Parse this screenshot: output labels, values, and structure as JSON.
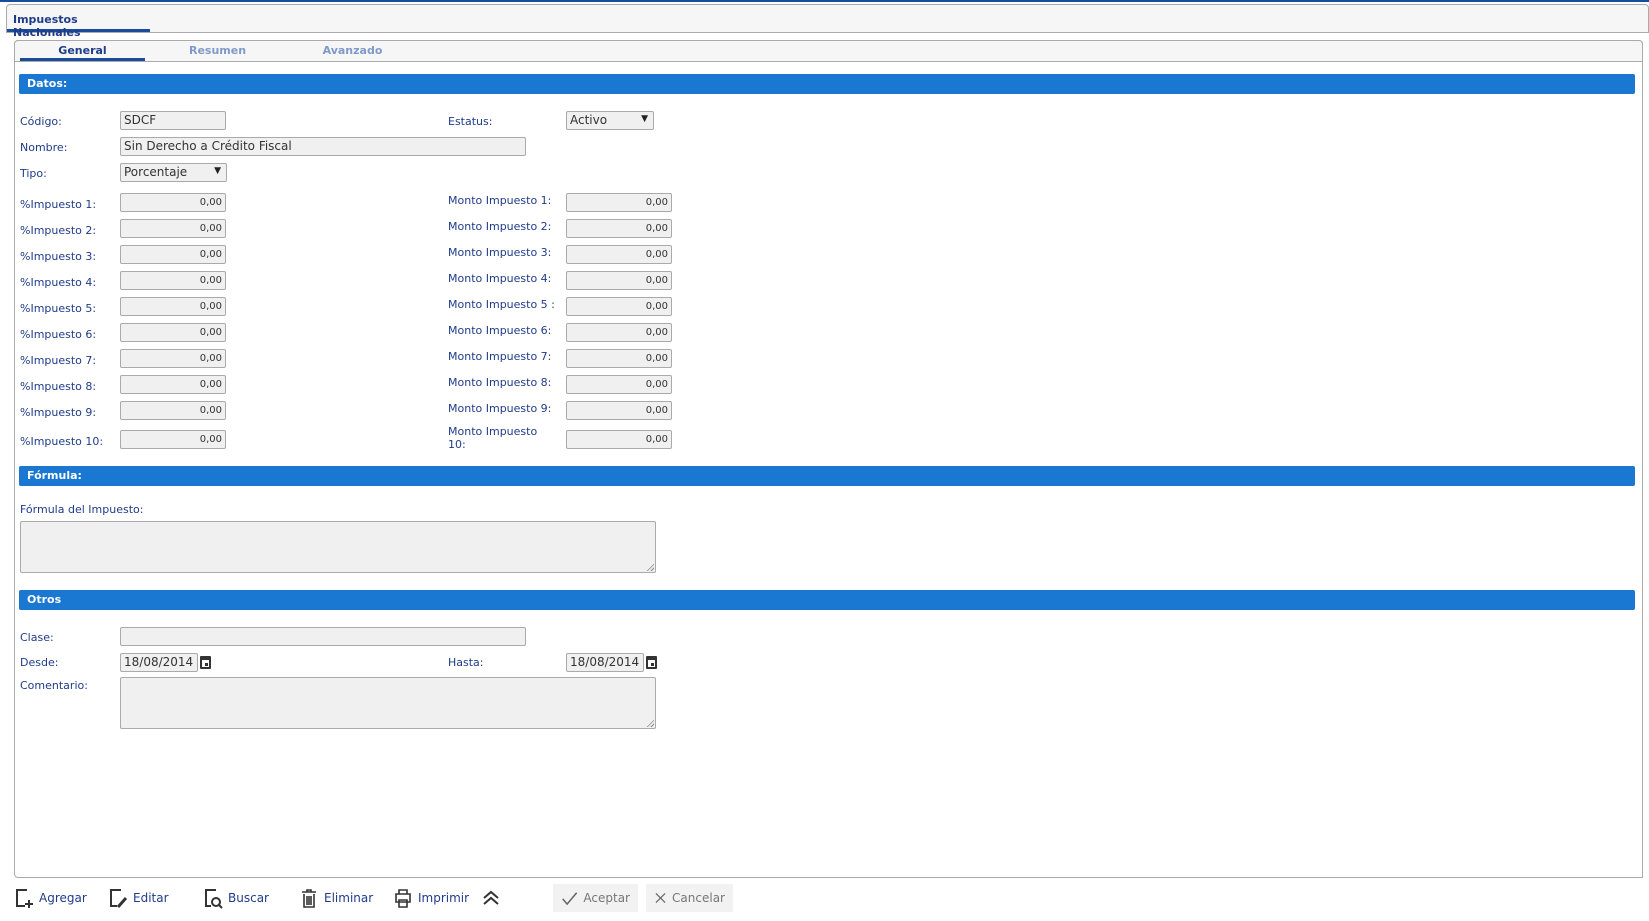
{
  "window": {
    "tab": "Impuestos Nacionales"
  },
  "subtabs": [
    "General",
    "Resumen",
    "Avanzado"
  ],
  "sections": {
    "datos": "Datos:",
    "formula": "Fórmula:",
    "otros": "Otros"
  },
  "datos": {
    "codigo_label": "Código:",
    "codigo": "SDCF",
    "estatus_label": "Estatus:",
    "estatus": "Activo",
    "nombre_label": "Nombre:",
    "nombre": "Sin Derecho a Crédito Fiscal",
    "tipo_label": "Tipo:",
    "tipo": "Porcentaje",
    "impuestos": [
      {
        "pct_label": "%Impuesto 1:",
        "pct": "0,00",
        "monto_label": "Monto Impuesto 1:",
        "monto": "0,00"
      },
      {
        "pct_label": "%Impuesto 2:",
        "pct": "0,00",
        "monto_label": "Monto Impuesto 2:",
        "monto": "0,00"
      },
      {
        "pct_label": "%Impuesto 3:",
        "pct": "0,00",
        "monto_label": "Monto Impuesto 3:",
        "monto": "0,00"
      },
      {
        "pct_label": "%Impuesto 4:",
        "pct": "0,00",
        "monto_label": "Monto Impuesto 4:",
        "monto": "0,00"
      },
      {
        "pct_label": "%Impuesto 5:",
        "pct": "0,00",
        "monto_label": "Monto Impuesto 5 :",
        "monto": "0,00"
      },
      {
        "pct_label": "%Impuesto 6:",
        "pct": "0,00",
        "monto_label": "Monto Impuesto 6:",
        "monto": "0,00"
      },
      {
        "pct_label": "%Impuesto 7:",
        "pct": "0,00",
        "monto_label": "Monto Impuesto 7:",
        "monto": "0,00"
      },
      {
        "pct_label": "%Impuesto 8:",
        "pct": "0,00",
        "monto_label": "Monto Impuesto 8:",
        "monto": "0,00"
      },
      {
        "pct_label": "%Impuesto 9:",
        "pct": "0,00",
        "monto_label": "Monto Impuesto 9:",
        "monto": "0,00"
      },
      {
        "pct_label": "%Impuesto 10:",
        "pct": "0,00",
        "monto_label": "Monto Impuesto 10:",
        "monto": "0,00"
      }
    ]
  },
  "formula": {
    "label": "Fórmula del Impuesto:",
    "value": ""
  },
  "otros": {
    "clase_label": "Clase:",
    "clase": "",
    "desde_label": "Desde:",
    "desde": "18/08/2014",
    "hasta_label": "Hasta:",
    "hasta": "18/08/2014",
    "comentario_label": "Comentario:",
    "comentario": ""
  },
  "footer": {
    "agregar": "Agregar",
    "editar": "Editar",
    "buscar": "Buscar",
    "eliminar": "Eliminar",
    "imprimir": "Imprimir",
    "aceptar": "Aceptar",
    "cancelar": "Cancelar"
  }
}
